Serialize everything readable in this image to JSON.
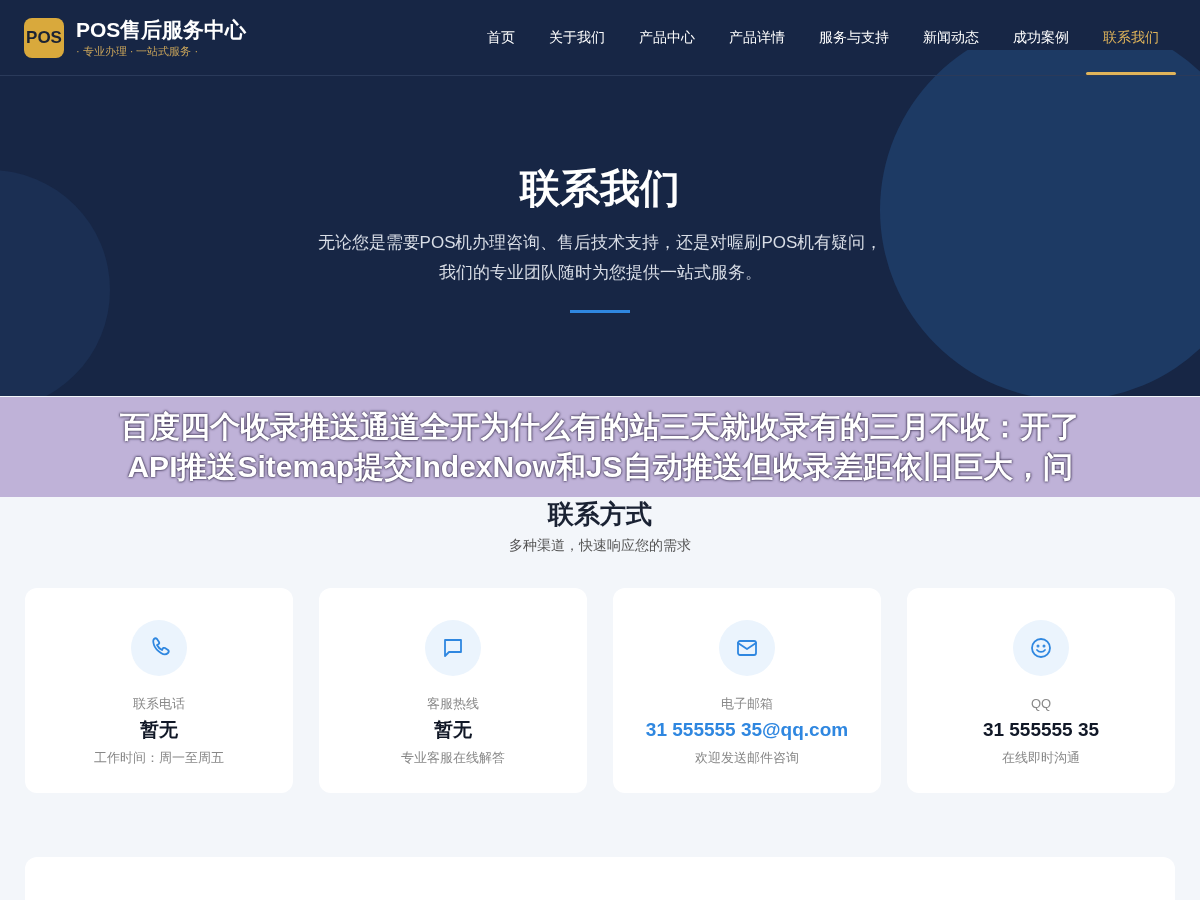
{
  "header": {
    "logo_text": "POS",
    "site_name": "POS售后服务中心",
    "tagline": "· 专业办理 · 一站式服务 ·"
  },
  "nav": [
    {
      "label": "首页",
      "selected": false
    },
    {
      "label": "关于我们",
      "selected": false
    },
    {
      "label": "产品中心",
      "selected": false
    },
    {
      "label": "产品详情",
      "selected": false
    },
    {
      "label": "服务与支持",
      "selected": false
    },
    {
      "label": "新闻动态",
      "selected": false
    },
    {
      "label": "成功案例",
      "selected": false
    },
    {
      "label": "联系我们",
      "selected": true
    }
  ],
  "hero": {
    "title": "联系我们",
    "lines": [
      "无论您是需要POS机办理咨询、售后技术支持，还是对喔刷POS机有疑问，",
      "我们的专业团队随时为您提供一站式服务。"
    ]
  },
  "overlay_banner": {
    "lines": [
      "百度四个收录推送通道全开为什么有的站三天就收录有的三月不收：开了",
      "API推送Sitemap提交IndexNow和JS自动推送但收录差距依旧巨大，问"
    ]
  },
  "contact": {
    "title": "联系方式",
    "subtitle": "多种渠道，快速响应您的需求",
    "cards": [
      {
        "label": "联系电话",
        "value": "暂无",
        "kind": "plain",
        "note": "工作时间：周一至周五"
      },
      {
        "label": "客服热线",
        "value": "暂无",
        "kind": "plain",
        "note": "专业客服在线解答"
      },
      {
        "label": "电子邮箱",
        "value": "31 555555 35@qq.com",
        "kind": "link",
        "note": "欢迎发送邮件咨询"
      },
      {
        "label": "QQ",
        "value": "31 555555 35",
        "kind": "plain",
        "note": "在线即时沟通"
      }
    ]
  }
}
